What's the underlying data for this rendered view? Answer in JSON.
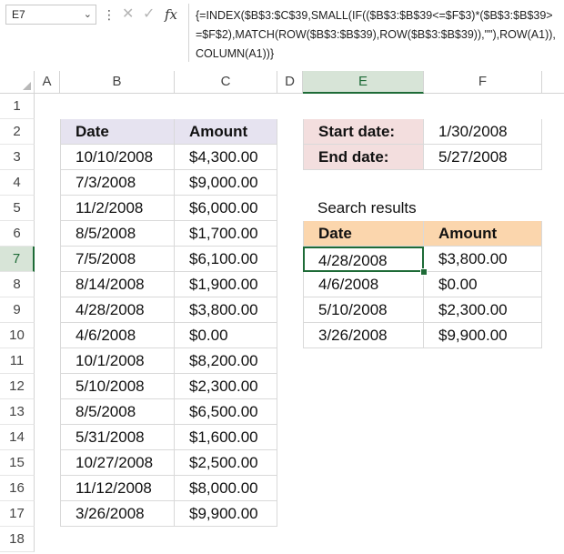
{
  "name_box": {
    "value": "E7",
    "dropdown_icon": "chevron-down-icon"
  },
  "formula_bar": {
    "more_icon": "vertical-dots-icon",
    "cancel_icon": "close-icon",
    "enter_icon": "checkmark-icon",
    "fx_label": "fx",
    "formula": "{=INDEX($B$3:$C$39,SMALL(IF(($B$3:$B$39<=$F$3)*($B$3:$B$39>=$F$2),MATCH(ROW($B$3:$B$39),ROW($B$3:$B$39)),\"\"),ROW(A1)),COLUMN(A1))}"
  },
  "columns": [
    "A",
    "B",
    "C",
    "D",
    "E",
    "F"
  ],
  "rows": [
    "1",
    "2",
    "3",
    "4",
    "5",
    "6",
    "7",
    "8",
    "9",
    "10",
    "11",
    "12",
    "13",
    "14",
    "15",
    "16",
    "17",
    "18"
  ],
  "source_table": {
    "headers": [
      "Date",
      "Amount"
    ],
    "rows": [
      [
        "10/10/2008",
        "$4,300.00"
      ],
      [
        "7/3/2008",
        "$9,000.00"
      ],
      [
        "11/2/2008",
        "$6,000.00"
      ],
      [
        "8/5/2008",
        "$1,700.00"
      ],
      [
        "7/5/2008",
        "$6,100.00"
      ],
      [
        "8/14/2008",
        "$1,900.00"
      ],
      [
        "4/28/2008",
        "$3,800.00"
      ],
      [
        "4/6/2008",
        "$0.00"
      ],
      [
        "10/1/2008",
        "$8,200.00"
      ],
      [
        "5/10/2008",
        "$2,300.00"
      ],
      [
        "8/5/2008",
        "$6,500.00"
      ],
      [
        "5/31/2008",
        "$1,600.00"
      ],
      [
        "10/27/2008",
        "$2,500.00"
      ],
      [
        "11/12/2008",
        "$8,000.00"
      ],
      [
        "3/26/2008",
        "$9,900.00"
      ]
    ]
  },
  "criteria": {
    "start_label": "Start date:",
    "start_value": "1/30/2008",
    "end_label": "End date:",
    "end_value": "5/27/2008"
  },
  "results": {
    "title": "Search results",
    "headers": [
      "Date",
      "Amount"
    ],
    "rows": [
      [
        "4/28/2008",
        "$3,800.00"
      ],
      [
        "4/6/2008",
        "$0.00"
      ],
      [
        "5/10/2008",
        "$2,300.00"
      ],
      [
        "3/26/2008",
        "$9,900.00"
      ]
    ]
  },
  "colors": {
    "accent": "#1e6b37",
    "purple_header": "#e6e3f0",
    "pink_header": "#f3dede",
    "orange_header": "#fbd6ad"
  }
}
